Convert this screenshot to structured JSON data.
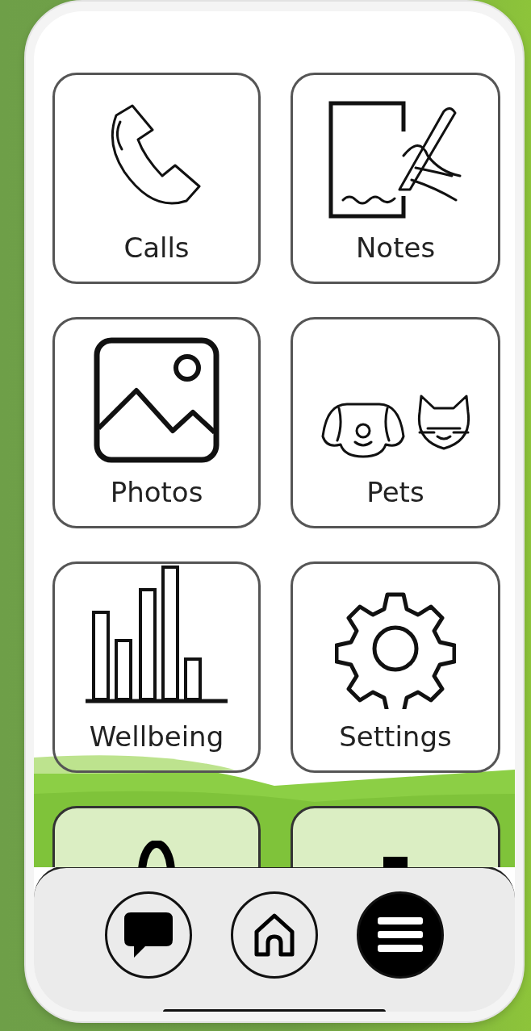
{
  "tiles": [
    {
      "label": "Calls"
    },
    {
      "label": "Notes"
    },
    {
      "label": "Photos"
    },
    {
      "label": "Pets"
    },
    {
      "label": "Wellbeing"
    },
    {
      "label": "Settings"
    }
  ],
  "nav": [
    {
      "selected": false
    },
    {
      "selected": false
    },
    {
      "selected": true
    }
  ]
}
